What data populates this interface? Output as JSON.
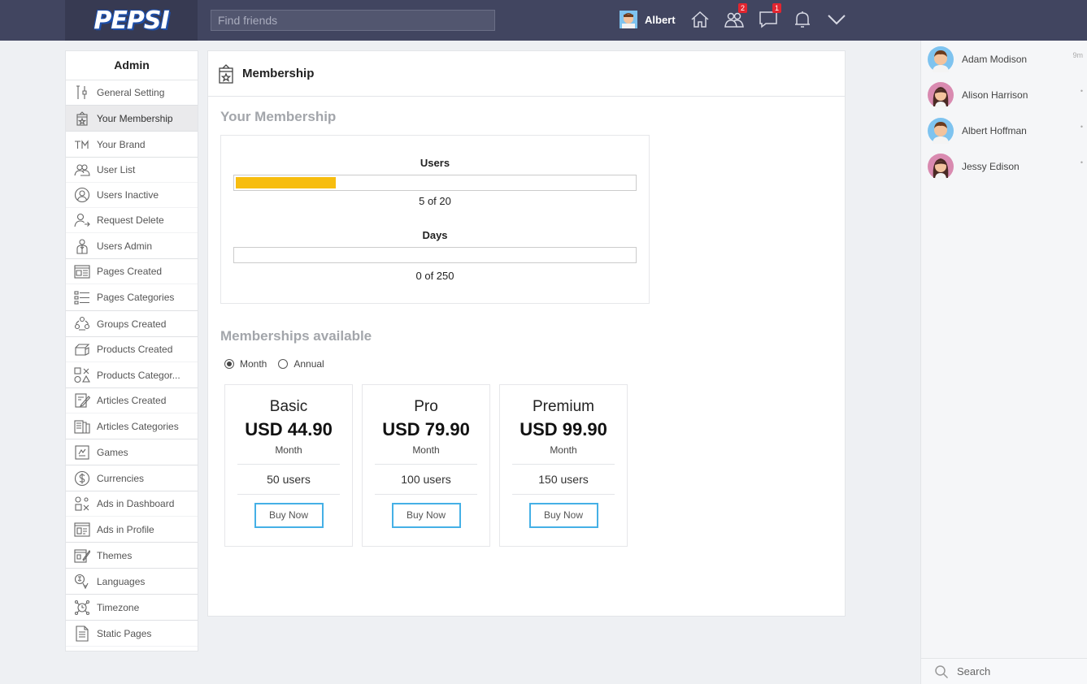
{
  "header": {
    "logo_text": "PEPSI",
    "search_placeholder": "Find friends",
    "user_name": "Albert",
    "friends_badge": "2",
    "messages_badge": "1"
  },
  "sidebar": {
    "title": "Admin",
    "items": [
      {
        "label": "General Setting",
        "icon": "settings-tools-icon"
      },
      {
        "label": "Your Membership",
        "icon": "membership-badge-icon",
        "active": true
      },
      {
        "label": "Your Brand",
        "icon": "trademark-icon"
      },
      {
        "label": "User List",
        "icon": "users-group-icon"
      },
      {
        "label": "Users Inactive",
        "icon": "user-circle-icon"
      },
      {
        "label": "Request Delete",
        "icon": "user-remove-icon"
      },
      {
        "label": "Users Admin",
        "icon": "admin-user-icon"
      },
      {
        "label": "Pages Created",
        "icon": "page-icon"
      },
      {
        "label": "Pages Categories",
        "icon": "list-icon"
      },
      {
        "label": "Groups Created",
        "icon": "group-icon"
      },
      {
        "label": "Products Created",
        "icon": "product-icon"
      },
      {
        "label": "Products Categor...",
        "icon": "category-shapes-icon"
      },
      {
        "label": "Articles Created",
        "icon": "article-edit-icon"
      },
      {
        "label": "Articles Categories",
        "icon": "articles-icon"
      },
      {
        "label": "Games",
        "icon": "game-icon"
      },
      {
        "label": "Currencies",
        "icon": "dollar-icon"
      },
      {
        "label": "Ads in Dashboard",
        "icon": "ads-dashboard-icon"
      },
      {
        "label": "Ads in Profile",
        "icon": "ads-profile-icon"
      },
      {
        "label": "Themes",
        "icon": "theme-icon"
      },
      {
        "label": "Languages",
        "icon": "language-icon"
      },
      {
        "label": "Timezone",
        "icon": "timezone-icon"
      },
      {
        "label": "Static Pages",
        "icon": "static-page-icon"
      }
    ]
  },
  "main": {
    "title": "Membership",
    "your_membership_title": "Your Membership",
    "users_label": "Users",
    "users_used": 5,
    "users_total": 20,
    "users_count_text": "5 of 20",
    "days_label": "Days",
    "days_used": 0,
    "days_total": 250,
    "days_count_text": "0 of 250",
    "available_title": "Memberships available",
    "billing": {
      "month": "Month",
      "annual": "Annual",
      "selected": "Month"
    },
    "plans": [
      {
        "name": "Basic",
        "price": "USD 44.90",
        "period": "Month",
        "users": "50 users",
        "button": "Buy Now"
      },
      {
        "name": "Pro",
        "price": "USD 79.90",
        "period": "Month",
        "users": "100 users",
        "button": "Buy Now"
      },
      {
        "name": "Premium",
        "price": "USD 99.90",
        "period": "Month",
        "users": "150 users",
        "button": "Buy Now"
      }
    ]
  },
  "contacts": [
    {
      "name": "Adam Modison",
      "meta": "9m",
      "gender": "male"
    },
    {
      "name": "Alison Harrison",
      "meta": "•",
      "gender": "female"
    },
    {
      "name": "Albert Hoffman",
      "meta": "•",
      "gender": "male"
    },
    {
      "name": "Jessy Edison",
      "meta": "•",
      "gender": "female"
    }
  ],
  "right_search_placeholder": "Search",
  "colors": {
    "topbar": "#414560",
    "progress": "#f7bd0f",
    "button_border": "#45b0e6"
  }
}
